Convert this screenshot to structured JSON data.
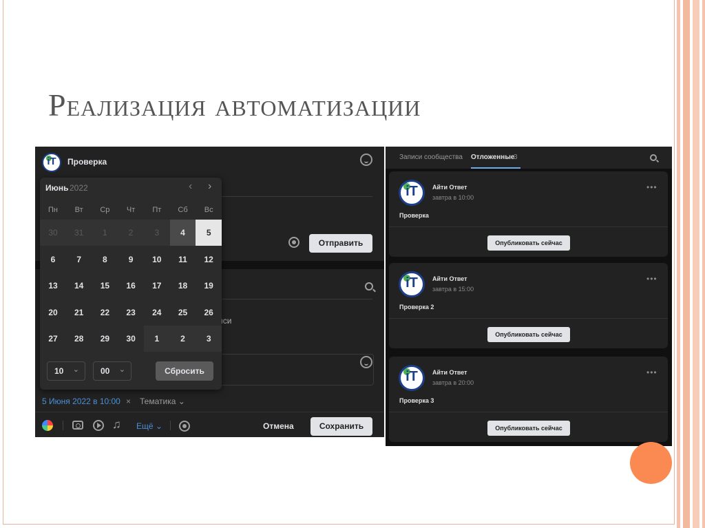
{
  "slide": {
    "title": "Реализация автоматизации",
    "accent_color": "#fb8a52"
  },
  "left_shot": {
    "community_name": "Проверка",
    "send_label": "Отправить",
    "peek_text": "иси",
    "scheduled_date": "5 Июня 2022 в 10:00",
    "clear_glyph": "×",
    "topic_label": "Тематика ⌄",
    "more_label": "Ещё ⌄",
    "cancel_label": "Отмена",
    "save_label": "Сохранить",
    "icons": [
      "smile-icon",
      "gear-icon",
      "search-icon",
      "color-icon",
      "camera-icon",
      "video-icon",
      "music-icon"
    ],
    "calendar": {
      "month": "Июнь",
      "year": "2022",
      "prev_glyph": "‹",
      "next_glyph": "›",
      "weekdays": [
        "Пн",
        "Вт",
        "Ср",
        "Чт",
        "Пт",
        "Сб",
        "Вс"
      ],
      "weeks": [
        [
          "30",
          "31",
          "1",
          "2",
          "3",
          "4",
          "5"
        ],
        [
          "6",
          "7",
          "8",
          "9",
          "10",
          "11",
          "12"
        ],
        [
          "13",
          "14",
          "15",
          "16",
          "17",
          "18",
          "19"
        ],
        [
          "20",
          "21",
          "22",
          "23",
          "24",
          "25",
          "26"
        ],
        [
          "27",
          "28",
          "29",
          "30",
          "1",
          "2",
          "3"
        ]
      ],
      "hour": "10",
      "minute": "00",
      "chevron_glyph": "⌄",
      "reset_label": "Сбросить"
    }
  },
  "right_shot": {
    "tab_community": "Записи сообщества",
    "tab_scheduled": "Отложенные",
    "tab_scheduled_count": "3",
    "tab_accent": "#71aaeb",
    "menu_glyph": "•••",
    "posts": [
      {
        "author": "Айти Ответ",
        "time": "завтра в 10:00",
        "text": "Проверка",
        "publish_label": "Опубликовать сейчас"
      },
      {
        "author": "Айти Ответ",
        "time": "завтра в 15:00",
        "text": "Проверка 2",
        "publish_label": "Опубликовать сейчас"
      },
      {
        "author": "Айти Ответ",
        "time": "завтра в 20:00",
        "text": "Проверка 3",
        "publish_label": "Опубликовать сейчас"
      }
    ]
  },
  "avatar_text": "iT"
}
